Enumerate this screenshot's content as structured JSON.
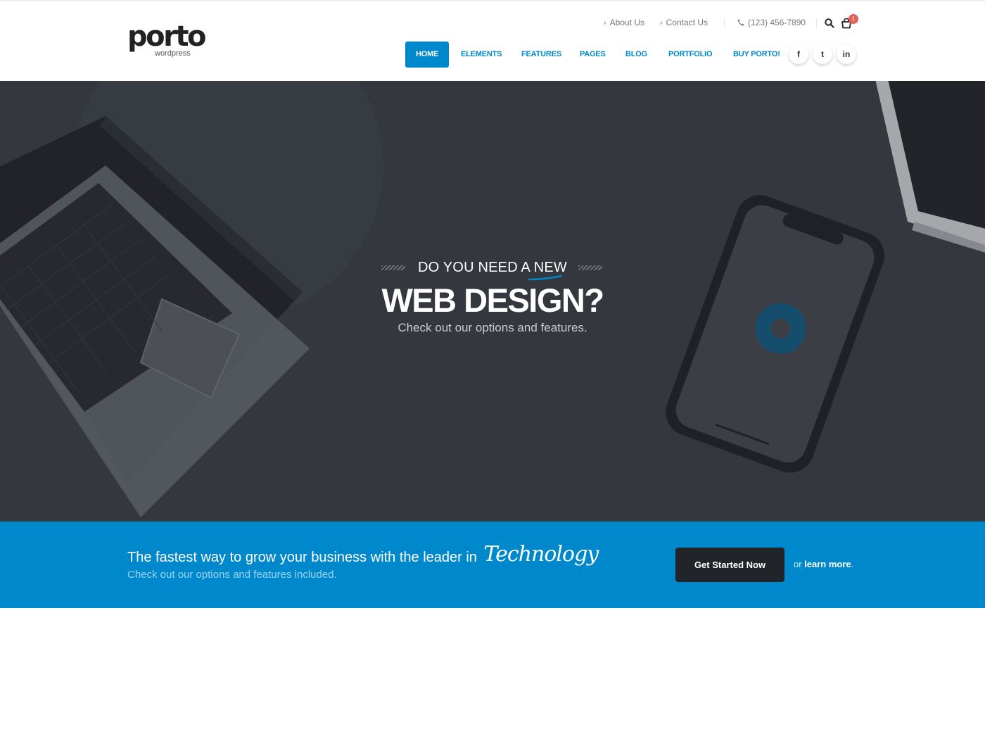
{
  "brand": {
    "name": "porto",
    "tagline": "wordpress"
  },
  "top_links": [
    {
      "label": "About Us"
    },
    {
      "label": "Contact Us"
    }
  ],
  "phone": "(123) 456-7890",
  "cart": {
    "count": "1"
  },
  "nav": {
    "items": [
      "HOME",
      "ELEMENTS",
      "FEATURES",
      "PAGES",
      "BLOG",
      "PORTFOLIO",
      "BUY PORTO!"
    ],
    "active": "HOME"
  },
  "social": [
    "f",
    "t",
    "in"
  ],
  "hero": {
    "pre_title_a": "DO YOU NEED A ",
    "pre_title_b": "NEW",
    "title": "WEB DESIGN?",
    "subtitle": "Check out our options and features."
  },
  "cta": {
    "title": "The fastest way to grow your business with the leader in",
    "highlight": "Technology",
    "subtitle": "Check out our options and features included.",
    "button": "Get Started Now",
    "or_text": "or ",
    "learn_more": "learn more",
    "period": "."
  },
  "colors": {
    "primary": "#0088cc",
    "dark": "#212529",
    "hero_bg": "#393d44",
    "badge": "#e36159"
  },
  "icons": [
    "chevron-right-icon",
    "phone-icon",
    "search-icon",
    "cart-icon",
    "facebook-icon",
    "twitter-icon",
    "linkedin-icon"
  ]
}
